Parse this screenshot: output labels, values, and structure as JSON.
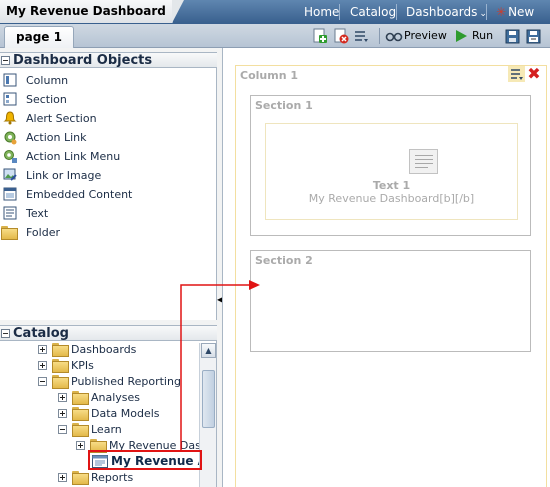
{
  "app": {
    "title": "My Revenue Dashboard",
    "nav": {
      "home": "Home",
      "catalog": "Catalog",
      "dashboards": "Dashboards",
      "new": "New"
    }
  },
  "page_tab": "page 1",
  "toolbar": {
    "preview": "Preview",
    "run": "Run"
  },
  "dashboard_objects": {
    "heading": "Dashboard Objects",
    "items": [
      {
        "label": "Column",
        "icon": "column-icon"
      },
      {
        "label": "Section",
        "icon": "section-icon"
      },
      {
        "label": "Alert Section",
        "icon": "bell-icon"
      },
      {
        "label": "Action Link",
        "icon": "action-link-icon"
      },
      {
        "label": "Action Link Menu",
        "icon": "action-link-menu-icon"
      },
      {
        "label": "Link or Image",
        "icon": "link-image-icon"
      },
      {
        "label": "Embedded Content",
        "icon": "embedded-content-icon"
      },
      {
        "label": "Text",
        "icon": "text-icon"
      },
      {
        "label": "Folder",
        "icon": "folder-icon"
      }
    ]
  },
  "catalog": {
    "heading": "Catalog",
    "tree": [
      {
        "label": "Dashboards",
        "state": "collapsed"
      },
      {
        "label": "KPIs",
        "state": "collapsed"
      },
      {
        "label": "Published Reporting",
        "state": "expanded"
      },
      {
        "label": "Analyses",
        "state": "collapsed"
      },
      {
        "label": "Data Models",
        "state": "collapsed"
      },
      {
        "label": "Learn",
        "state": "expanded"
      },
      {
        "label": "My Revenue Dashb",
        "state": "collapsed"
      },
      {
        "label": "My Revenue An",
        "state": "selected"
      },
      {
        "label": "Reports",
        "state": "collapsed"
      }
    ]
  },
  "canvas": {
    "column_label": "Column 1",
    "section1_label": "Section 1",
    "section2_label": "Section 2",
    "text_title": "Text 1",
    "text_body": "My Revenue Dashboard[b][/b]"
  },
  "colors": {
    "highlight": "#e01414",
    "nav_bar": "#385f8d"
  }
}
